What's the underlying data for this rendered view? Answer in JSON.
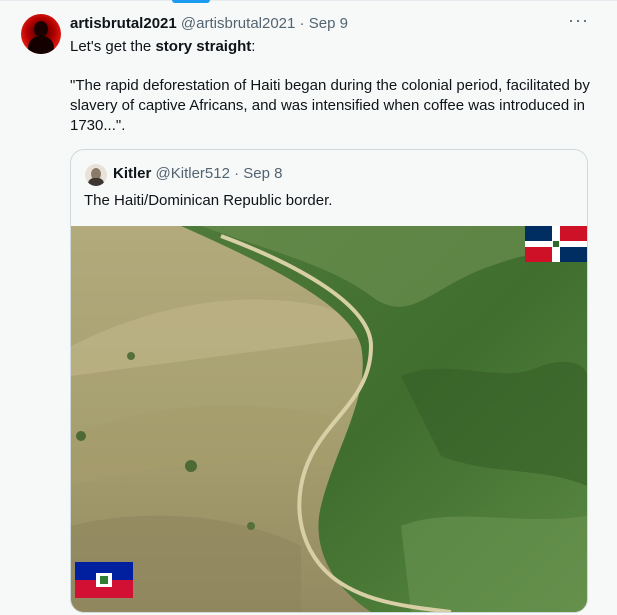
{
  "tweet": {
    "display_name": "artisbrutal2021",
    "handle": "@artisbrutal2021",
    "separator": "·",
    "date": "Sep 9",
    "more_label": "···",
    "line1_pre": "Let's get the ",
    "line1_bold": "story straight",
    "line1_post": ":",
    "quote_text": "\"The rapid deforestation of Haiti began during the colonial period, facilitated by slavery of captive Africans, and was intensified when coffee was introduced in 1730...\"."
  },
  "quoted": {
    "display_name": "Kitler",
    "handle": "@Kitler512",
    "separator": "·",
    "date": "Sep 8",
    "text": "The Haiti/Dominican Republic border."
  },
  "colors": {
    "accent": "#1d9bf0",
    "text": "#0f1419",
    "muted": "#536471",
    "border": "#cfd9de",
    "background": "#f7f9f9"
  },
  "icons": {
    "more": "more-horizontal-icon",
    "dominican_flag": "dominican-republic-flag-icon",
    "haiti_flag": "haiti-flag-icon"
  }
}
